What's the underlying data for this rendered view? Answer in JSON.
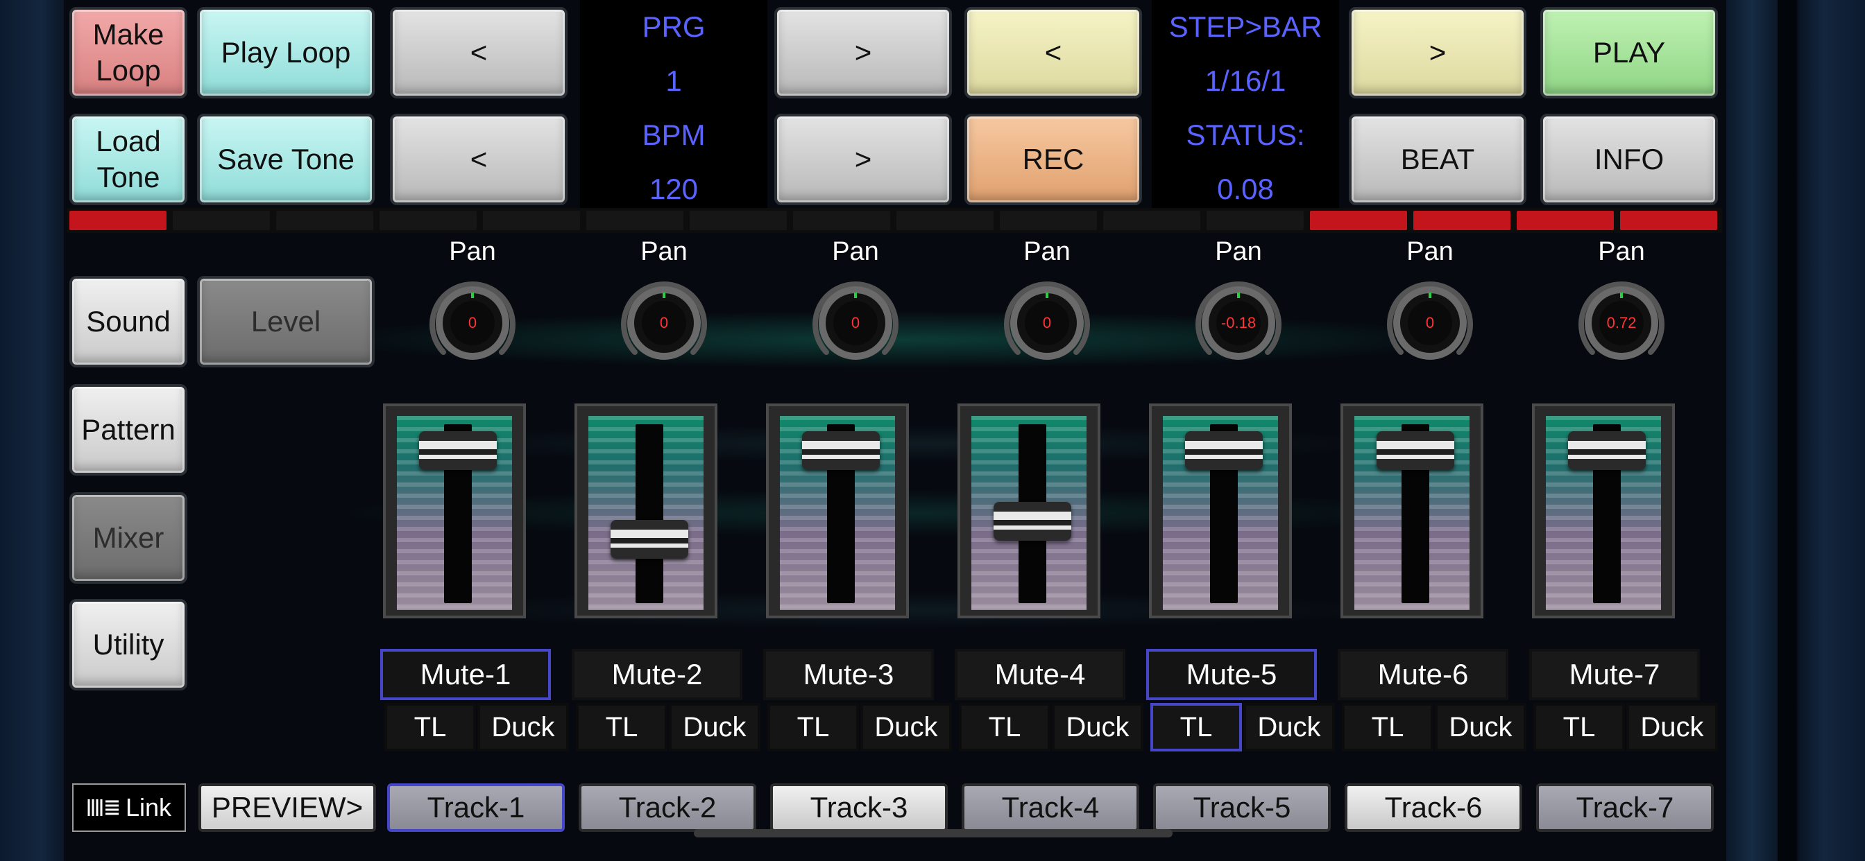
{
  "transport": {
    "make_loop": "Make Loop",
    "play_loop": "Play Loop",
    "load_tone": "Load Tone",
    "save_tone": "Save Tone",
    "prg_prev": "<",
    "prg_next": ">",
    "bpm_prev": "<",
    "bpm_next": ">",
    "step_prev": "<",
    "step_next": ">",
    "rec": "REC",
    "play": "PLAY",
    "beat": "BEAT",
    "info": "INFO"
  },
  "display": {
    "prg_label": "PRG",
    "prg_value": "1",
    "bpm_label": "BPM",
    "bpm_value": "120",
    "step_label": "STEP>BAR",
    "step_value": "1/16/1",
    "status_label": "STATUS:",
    "status_value": "0.08"
  },
  "side_menu": {
    "sound": "Sound",
    "level": "Level",
    "pattern": "Pattern",
    "mixer": "Mixer",
    "utility": "Utility"
  },
  "steps_active": [
    true,
    false,
    false,
    false,
    false,
    false,
    false,
    false,
    false,
    false,
    false,
    false,
    true,
    true,
    true,
    true
  ],
  "channels": [
    {
      "pan_label": "Pan",
      "pan_value": "0",
      "level": 0.92,
      "mute": "Mute-1",
      "mute_selected": true,
      "tl": "TL",
      "tl_selected": false,
      "duck": "Duck",
      "track": "Track-1",
      "track_selected": true,
      "track_style": "dark"
    },
    {
      "pan_label": "Pan",
      "pan_value": "0",
      "level": 0.28,
      "mute": "Mute-2",
      "mute_selected": false,
      "tl": "TL",
      "tl_selected": false,
      "duck": "Duck",
      "track": "Track-2",
      "track_selected": false,
      "track_style": "dark"
    },
    {
      "pan_label": "Pan",
      "pan_value": "0",
      "level": 0.92,
      "mute": "Mute-3",
      "mute_selected": false,
      "tl": "TL",
      "tl_selected": false,
      "duck": "Duck",
      "track": "Track-3",
      "track_selected": false,
      "track_style": "light"
    },
    {
      "pan_label": "Pan",
      "pan_value": "0",
      "level": 0.41,
      "mute": "Mute-4",
      "mute_selected": false,
      "tl": "TL",
      "tl_selected": false,
      "duck": "Duck",
      "track": "Track-4",
      "track_selected": false,
      "track_style": "dark"
    },
    {
      "pan_label": "Pan",
      "pan_value": "-0.18",
      "level": 0.92,
      "mute": "Mute-5",
      "mute_selected": true,
      "tl": "TL",
      "tl_selected": true,
      "duck": "Duck",
      "track": "Track-5",
      "track_selected": false,
      "track_style": "dark"
    },
    {
      "pan_label": "Pan",
      "pan_value": "0",
      "level": 0.92,
      "mute": "Mute-6",
      "mute_selected": false,
      "tl": "TL",
      "tl_selected": false,
      "duck": "Duck",
      "track": "Track-6",
      "track_selected": false,
      "track_style": "light"
    },
    {
      "pan_label": "Pan",
      "pan_value": "0.72",
      "level": 0.92,
      "mute": "Mute-7",
      "mute_selected": false,
      "tl": "TL",
      "tl_selected": false,
      "duck": "Duck",
      "track": "Track-7",
      "track_selected": false,
      "track_style": "dark"
    }
  ],
  "footer": {
    "link_label": "Link",
    "preview_label": "PREVIEW>"
  },
  "colors": {
    "accent_blue": "#5a63ff",
    "selection_border": "#4646c8",
    "step_on": "#c4141c",
    "knob_value": "#ff3434"
  }
}
